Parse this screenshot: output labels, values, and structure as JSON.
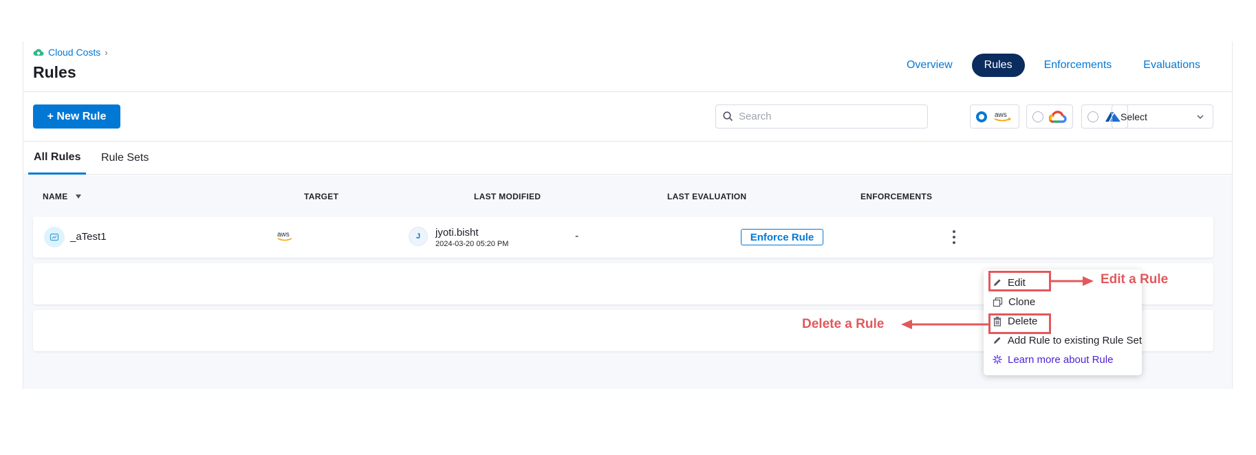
{
  "breadcrumb": {
    "label": "Cloud Costs"
  },
  "page": {
    "title": "Rules"
  },
  "nav": {
    "tabs": [
      {
        "label": "Overview"
      },
      {
        "label": "Rules"
      },
      {
        "label": "Enforcements"
      },
      {
        "label": "Evaluations"
      }
    ],
    "active": "Rules"
  },
  "toolbar": {
    "new_rule_label": "+ New Rule",
    "search_placeholder": "Search",
    "providers": [
      {
        "name": "aws-logo",
        "selected": true
      },
      {
        "name": "gcp-logo",
        "selected": false
      },
      {
        "name": "azure-logo",
        "selected": false
      }
    ],
    "select_label": "Select"
  },
  "subtabs": [
    {
      "label": "All Rules"
    },
    {
      "label": "Rule Sets"
    }
  ],
  "table": {
    "columns": [
      "NAME",
      "TARGET",
      "LAST MODIFIED",
      "LAST EVALUATION",
      "ENFORCEMENTS"
    ],
    "rows": [
      {
        "name": "_aTest1",
        "target": "aws",
        "user_initial": "J",
        "user": "jyoti.bisht",
        "modified": "2024-03-20 05:20 PM",
        "last_evaluation": "-",
        "enforce_label": "Enforce Rule"
      }
    ]
  },
  "menu": {
    "items": [
      {
        "label": "Edit",
        "icon": "pencil-icon"
      },
      {
        "label": "Clone",
        "icon": "clone-icon"
      },
      {
        "label": "Delete",
        "icon": "trash-icon"
      },
      {
        "label": "Add Rule to existing Rule Set",
        "icon": "pencil-icon"
      },
      {
        "label": "Learn more about Rule",
        "icon": "sparkle-icon"
      }
    ]
  },
  "annotations": {
    "edit": "Edit a Rule",
    "delete": "Delete a Rule"
  },
  "colors": {
    "accent": "#0278d5",
    "nav_active": "#0b2c5e",
    "annotation": "#e2585b",
    "learn_link": "#4b1ed6"
  }
}
